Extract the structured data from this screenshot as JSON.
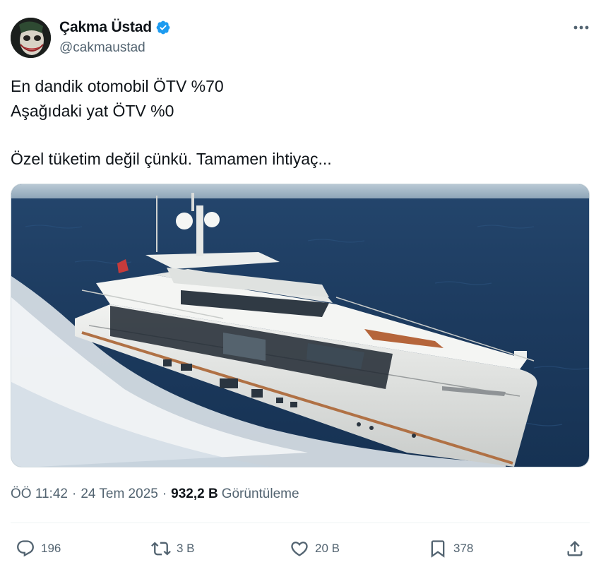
{
  "author": {
    "display_name": "Çakma Üstad",
    "handle": "@cakmaustad",
    "verified": true,
    "verified_color": "#1d9bf0"
  },
  "tweet": {
    "lines": [
      "En dandik otomobil ÖTV %70",
      "Aşağıdaki yat ÖTV %0",
      "",
      "Özel tüketim değil çünkü. Tamamen ihtiyaç..."
    ],
    "media": {
      "icon": "yacht-photo"
    },
    "time": "ÖÖ 11:42",
    "date": "24 Tem 2025",
    "separator": "·",
    "views_count": "932,2 B",
    "views_label": "Görüntüleme"
  },
  "actions": {
    "reply": {
      "count": "196",
      "icon": "reply-icon"
    },
    "retweet": {
      "count": "3 B",
      "icon": "retweet-icon"
    },
    "like": {
      "count": "20 B",
      "icon": "heart-icon"
    },
    "bookmark": {
      "count": "378",
      "icon": "bookmark-icon"
    },
    "share": {
      "icon": "share-icon"
    }
  },
  "colors": {
    "text": "#0f1419",
    "secondary": "#536471",
    "divider": "#eff3f4"
  }
}
